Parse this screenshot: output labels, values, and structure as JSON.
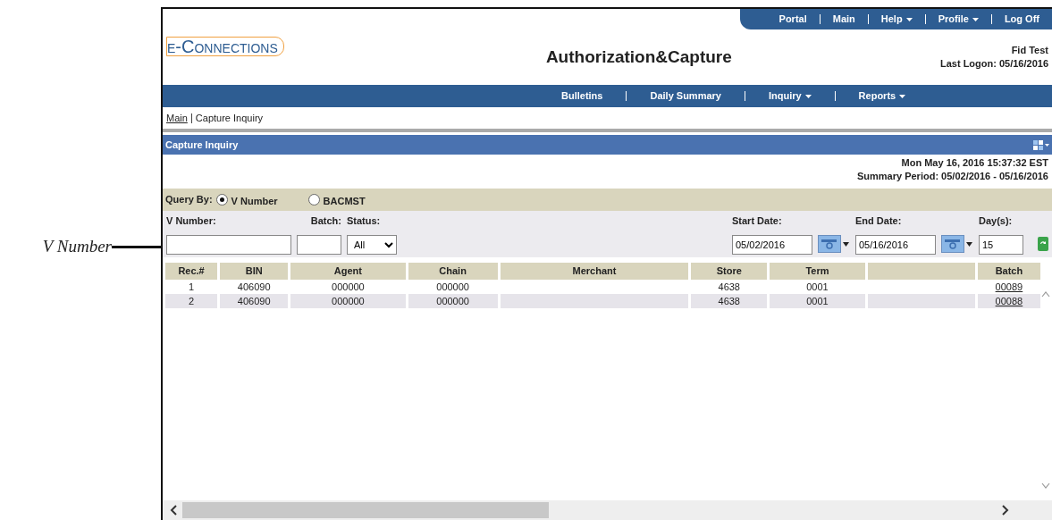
{
  "callout": {
    "label": "V Number"
  },
  "top_nav": [
    {
      "label": "Portal",
      "dropdown": false
    },
    {
      "label": "Main",
      "dropdown": false
    },
    {
      "label": "Help",
      "dropdown": true
    },
    {
      "label": "Profile",
      "dropdown": true
    },
    {
      "label": "Log Off",
      "dropdown": false
    }
  ],
  "logo": "e-Connections",
  "app_title": "Authorization&Capture",
  "user": {
    "name": "Fid Test",
    "last_logon": "Last Logon: 05/16/2016"
  },
  "main_nav": [
    {
      "label": "Bulletins",
      "dropdown": false
    },
    {
      "label": "Daily Summary",
      "dropdown": false
    },
    {
      "label": "Inquiry",
      "dropdown": true
    },
    {
      "label": "Reports",
      "dropdown": true
    }
  ],
  "breadcrumb": [
    {
      "label": "Main",
      "link": true
    },
    {
      "label": "Capture Inquiry",
      "link": false
    }
  ],
  "panel": {
    "title": "Capture Inquiry",
    "timestamp": "Mon May 16, 2016 15:37:32 EST",
    "summary_period": "Summary Period: 05/02/2016 - 05/16/2016"
  },
  "query_by": {
    "label": "Query By:",
    "options": [
      {
        "label": "V Number",
        "selected": true
      },
      {
        "label": "BACMST",
        "selected": false
      }
    ]
  },
  "filters": {
    "v_number": {
      "label": "V Number:"
    },
    "batch": {
      "label": "Batch:"
    },
    "status": {
      "label": "Status:",
      "value": "All"
    },
    "start_date": {
      "label": "Start Date:",
      "value": "05/02/2016"
    },
    "end_date": {
      "label": "End Date:",
      "value": "05/16/2016"
    },
    "days": {
      "label": "Day(s):",
      "value": "15"
    }
  },
  "table": {
    "columns": [
      "Rec.#",
      "BIN",
      "Agent",
      "Chain",
      "Merchant",
      "Store",
      "Term",
      "",
      "Batch"
    ],
    "rows": [
      {
        "cells": [
          "1",
          "406090",
          "000000",
          "000000",
          "",
          "4638",
          "0001",
          "",
          "00089"
        ]
      },
      {
        "cells": [
          "2",
          "406090",
          "000000",
          "000000",
          "",
          "4638",
          "0001",
          "",
          "00088"
        ]
      }
    ]
  }
}
